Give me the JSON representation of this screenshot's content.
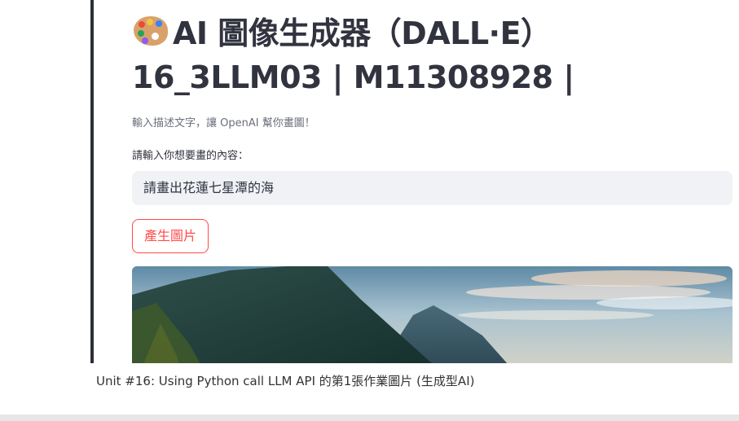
{
  "header": {
    "title_line1": "AI 圖像生成器（DALL·E）",
    "title_line2": "16_3LLM03 | M11308928 |",
    "title_icon": "artist-palette-icon"
  },
  "description": "輸入描述文字，讓 OpenAI 幫你畫圖！",
  "prompt_input": {
    "label": "請輸入你想要畫的內容：",
    "value": "請畫出花蓮七星潭的海"
  },
  "generate_button": {
    "label": "產生圖片"
  },
  "result_image": {
    "subject": "generated-coastal-mountain-image"
  },
  "footer_caption": "Unit #16: Using Python call LLM API 的第1張作業圖片 (生成型AI)",
  "colors": {
    "accent": "#ff4b4b",
    "text": "#31333f",
    "input_bg": "#f0f2f6",
    "rule": "#2b2f3a"
  }
}
